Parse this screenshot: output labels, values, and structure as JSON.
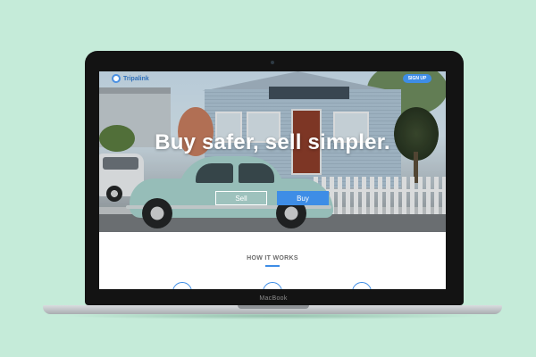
{
  "device": {
    "label": "MacBook"
  },
  "site": {
    "brand": "Tripalink",
    "nav": {
      "signup_label": "SIGN UP"
    },
    "hero": {
      "headline": "Buy safer, sell simpler.",
      "sell_label": "Sell",
      "buy_label": "Buy"
    },
    "how_it_works": {
      "title": "HOW IT WORKS",
      "step_icons": [
        "step-1-icon",
        "step-2-icon",
        "step-3-icon"
      ]
    }
  },
  "colors": {
    "background": "#c5ebd9",
    "accent": "#3e8de6",
    "laptop_bezel": "#131313"
  }
}
